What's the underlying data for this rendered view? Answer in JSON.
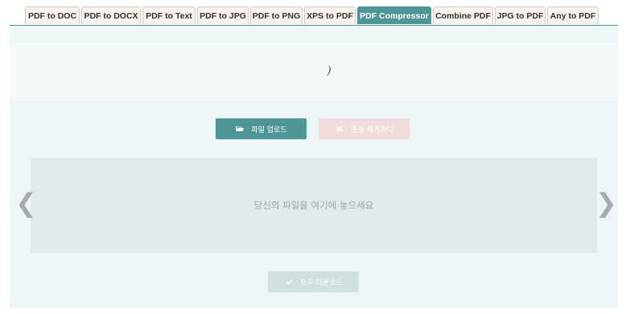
{
  "tabs": [
    {
      "label": "PDF to DOC"
    },
    {
      "label": "PDF to DOCX"
    },
    {
      "label": "PDF to Text"
    },
    {
      "label": "PDF to JPG"
    },
    {
      "label": "PDF to PNG"
    },
    {
      "label": "XPS to PDF"
    },
    {
      "label": "PDF Compressor",
      "active": true
    },
    {
      "label": "Combine PDF"
    },
    {
      "label": "JPG to PDF"
    },
    {
      "label": "Any to PDF"
    }
  ],
  "header": {
    "glyph": ")"
  },
  "toolbar": {
    "upload_label": "파일 업로드",
    "upload_icon": "folder-open-icon",
    "remove_label": "줄을 제거하다",
    "remove_icon": "close-icon"
  },
  "dropzone": {
    "text": "당신의 파일을 여기에 놓으세요"
  },
  "nav": {
    "prev": "❮",
    "next": "❯"
  },
  "download": {
    "label": "모두 다운로드",
    "icon": "check-icon"
  },
  "colors": {
    "accent": "#4e9595",
    "tab_bg": "#f7f2ee",
    "remove_bg": "#f0dcd8",
    "panel_bg": "#edf6f6",
    "dropzone_bg": "#e0eaea"
  }
}
